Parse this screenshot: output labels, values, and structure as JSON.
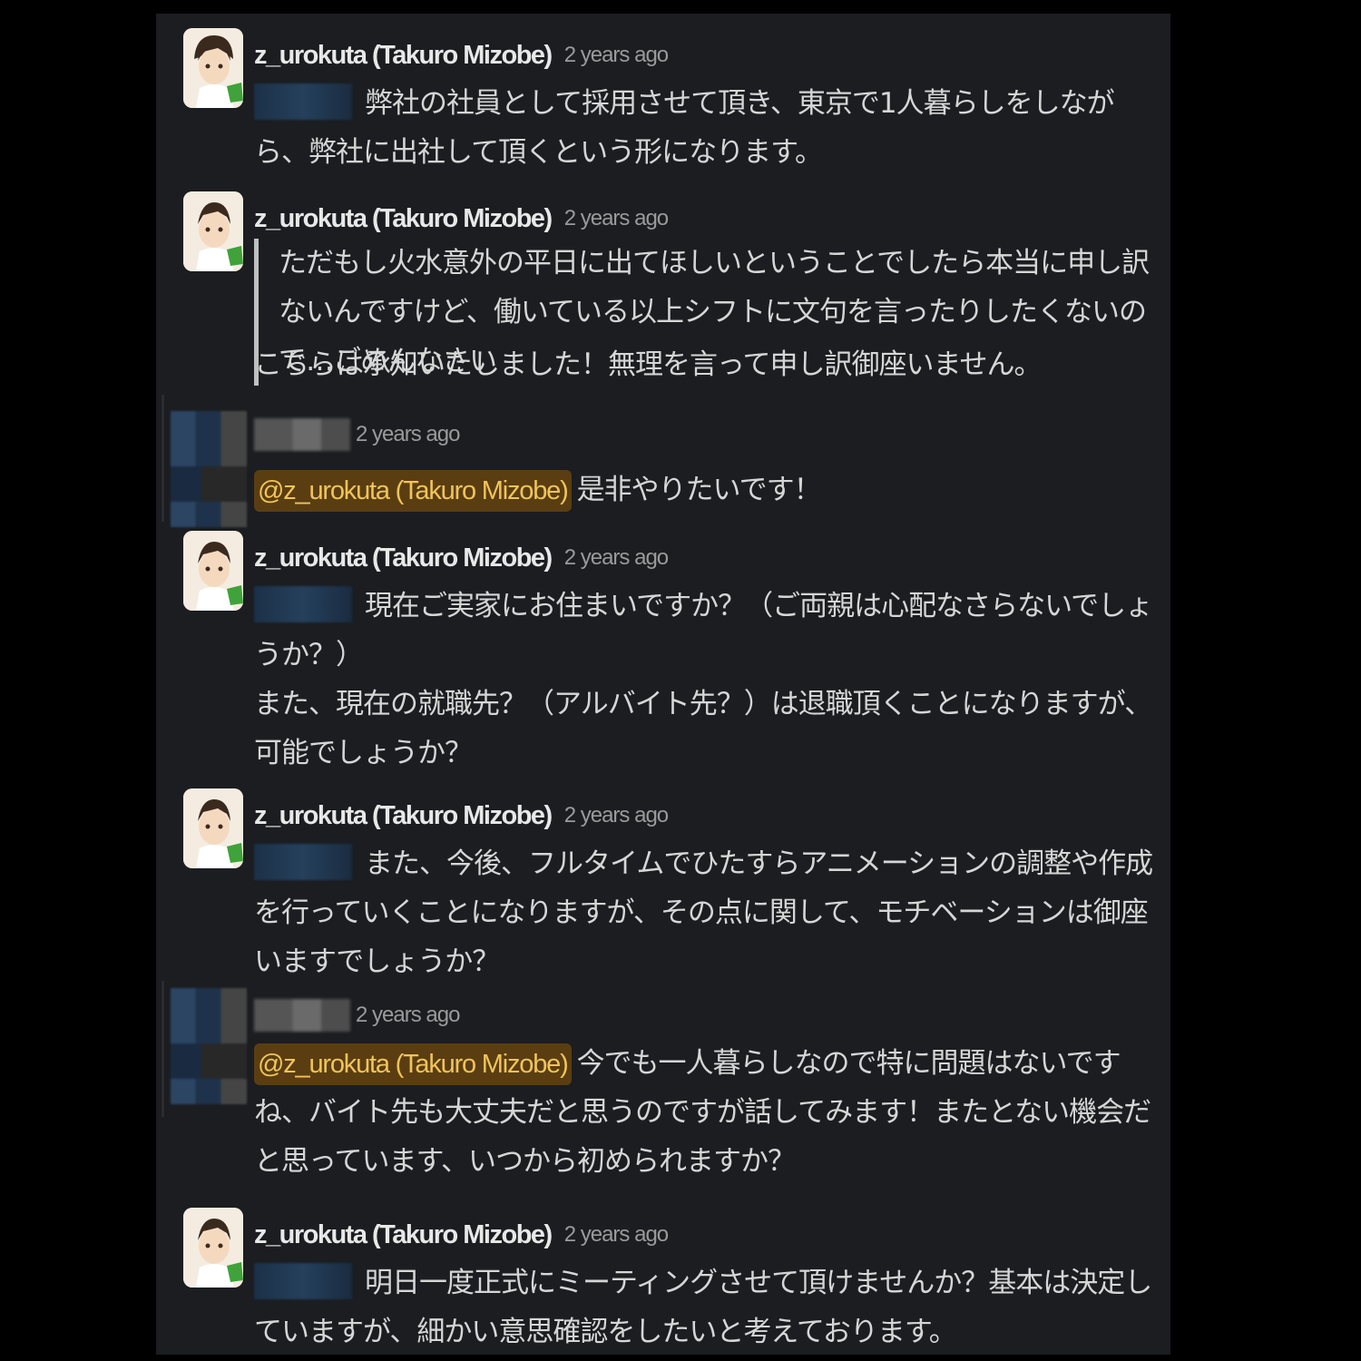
{
  "messages": [
    {
      "author": "z_urokuta (Takuro Mizobe)",
      "time": "2 years ago",
      "text": "弊社の社員として採用させて頂き、東京で1人暮らしをしながら、弊社に出社して頂くという形になります。"
    },
    {
      "author": "z_urokuta (Takuro Mizobe)",
      "time": "2 years ago",
      "quote": "ただもし火水意外の平日に出てほしいということでしたら本当に申し訳ないんですけど、働いている以上シフトに文句を言ったりしたくないので…ごめんなさい",
      "text": "こちらは承知いたしました！無理を言って申し訳御座いません。"
    },
    {
      "author": "",
      "time": "2 years ago",
      "mention": "@z_urokuta (Takuro Mizobe)",
      "text": "是非やりたいです！"
    },
    {
      "author": "z_urokuta (Takuro Mizobe)",
      "time": "2 years ago",
      "text": "現在ご実家にお住まいですか？（ご両親は心配なさらないでしょうか？）",
      "text2": "また、現在の就職先？（アルバイト先？）は退職頂くことになりますが、可能でしょうか？"
    },
    {
      "author": "z_urokuta (Takuro Mizobe)",
      "time": "2 years ago",
      "text": "また、今後、フルタイムでひたすらアニメーションの調整や作成を行っていくことになりますが、その点に関して、モチベーションは御座いますでしょうか？"
    },
    {
      "author": "",
      "time": "2 years ago",
      "mention": "@z_urokuta (Takuro Mizobe)",
      "text": "今でも一人暮らしなので特に問題はないですね、バイト先も大丈夫だと思うのですが話してみます！またとない機会だと思っています、いつから初められますか？"
    },
    {
      "author": "z_urokuta (Takuro Mizobe)",
      "time": "2 years ago",
      "text": "明日一度正式にミーティングさせて頂けませんか？基本は決定していますが、細かい意思確認をしたいと考えております。"
    }
  ],
  "colors": {
    "background": "#1b1d21",
    "mention_bg": "#5a3e12",
    "mention_text": "#f0c45a"
  },
  "icons": {
    "user_avatar": "anime-character-avatar",
    "redacted_avatar": "pixelated-avatar"
  }
}
